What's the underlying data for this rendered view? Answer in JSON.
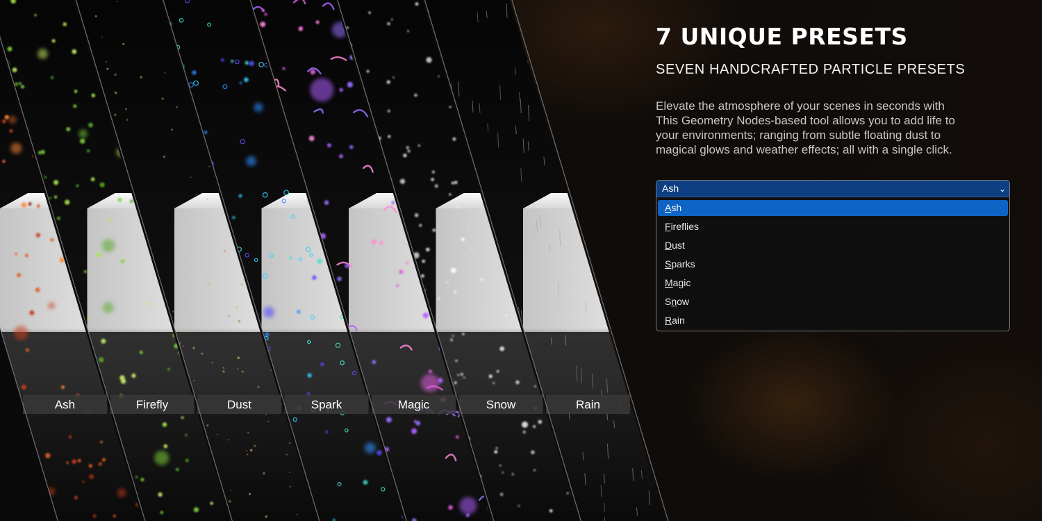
{
  "header": {
    "title": "7 UNIQUE PRESETS",
    "subtitle": "SEVEN HANDCRAFTED PARTICLE PRESETS"
  },
  "description": {
    "lines": [
      "Elevate the atmosphere of your scenes in seconds with",
      "This Geometry Nodes-based tool allows you to add life to",
      "your environments; ranging from subtle floating dust to",
      "magical glows and weather effects; all with a single click."
    ]
  },
  "dropdown": {
    "selected": "Ash",
    "options": [
      "Ash",
      "Fireflies",
      "Dust",
      "Sparks",
      "Magic",
      "Snow",
      "Rain"
    ],
    "accelerators": [
      0,
      0,
      0,
      0,
      0,
      1,
      0
    ],
    "highlighted_index": 0,
    "chevron_icon": "chevron-down-icon"
  },
  "panels": [
    {
      "label": "Ash",
      "colors": [
        "#e0602a",
        "#c8401e",
        "#ff8a3a",
        "#9a2a18"
      ],
      "kind": "ember"
    },
    {
      "label": "Firefly",
      "colors": [
        "#7ed23a",
        "#a9e84a",
        "#5aa82a",
        "#c6f06a"
      ],
      "kind": "glow"
    },
    {
      "label": "Dust",
      "colors": [
        "#c89a50",
        "#a07840",
        "#e0b870"
      ],
      "kind": "dust"
    },
    {
      "label": "Spark",
      "colors": [
        "#2e8cff",
        "#34d0ff",
        "#5a50ff",
        "#48e0d0"
      ],
      "kind": "spark"
    },
    {
      "label": "Magic",
      "colors": [
        "#b060ff",
        "#e060e0",
        "#9a70ff",
        "#ff8ad8"
      ],
      "kind": "magic"
    },
    {
      "label": "Snow",
      "colors": [
        "#ffffff",
        "#dcdcdc",
        "#f4f4f4"
      ],
      "kind": "snow"
    },
    {
      "label": "Rain",
      "colors": [
        "#9a9a9a",
        "#bdbdbd"
      ],
      "kind": "rain"
    }
  ],
  "theme": {
    "accent": "#0e63c4",
    "select_bg": "#0d3f82",
    "cube_color": "#d9d9d9",
    "label_bar": "#3a3a3a"
  }
}
